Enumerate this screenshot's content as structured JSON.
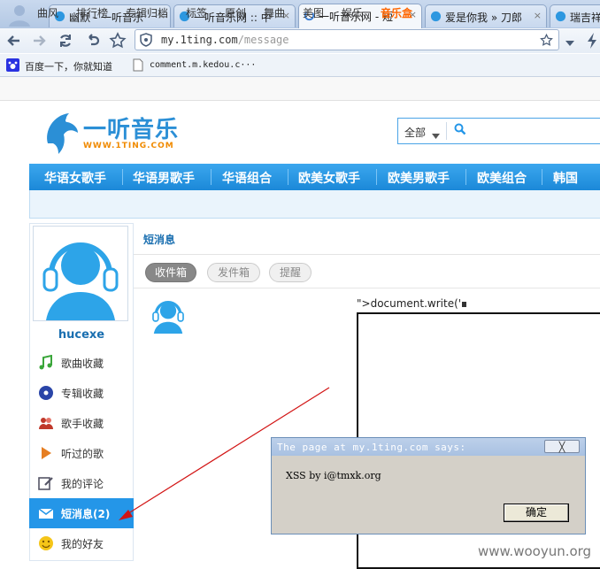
{
  "browser": {
    "tabs": [
      {
        "label": "幽默 - 一听音乐"
      },
      {
        "label": "一听音乐网 :: 中"
      },
      {
        "label": "一听音乐网 - 短"
      },
      {
        "label": "爱是你我 » 刀郎"
      },
      {
        "label": "瑞吉祥"
      }
    ],
    "tab_close": "×",
    "url": {
      "domain": "my.1ting.com",
      "path": "/message"
    },
    "bookmarks": [
      {
        "label": "百度一下，你就知道"
      },
      {
        "label": "comment.m.kedou.c···"
      }
    ]
  },
  "site": {
    "top_menu": [
      "曲风",
      "排行榜",
      "专辑归档",
      "标签",
      "原创",
      "舞曲",
      "美图",
      "娱乐",
      "音乐盒"
    ],
    "logo": {
      "name": "一听音乐",
      "sub": "WWW.1TING.COM"
    },
    "search": {
      "scope": "全部"
    },
    "nav": [
      "华语女歌手",
      "华语男歌手",
      "华语组合",
      "欧美女歌手",
      "欧美男歌手",
      "欧美组合",
      "韩国"
    ]
  },
  "sidebar": {
    "username": "hucexe",
    "items": [
      {
        "label": "歌曲收藏",
        "icon": "music-note-icon"
      },
      {
        "label": "专辑收藏",
        "icon": "disc-icon"
      },
      {
        "label": "歌手收藏",
        "icon": "singers-icon"
      },
      {
        "label": "听过的歌",
        "icon": "play-icon"
      },
      {
        "label": "我的评论",
        "icon": "edit-icon"
      },
      {
        "label": "短消息(2)",
        "icon": "envelope-icon"
      },
      {
        "label": "我的好友",
        "icon": "smiley-icon"
      }
    ]
  },
  "main": {
    "title": "短消息",
    "tabs": [
      "收件箱",
      "发件箱",
      "提醒"
    ],
    "message_text": "\">document.write('"
  },
  "dialog": {
    "title": "The page at my.1ting.com says:",
    "message": "XSS by i@tmxk.org",
    "ok": "确定",
    "close": "╳"
  },
  "watermark": "www.wooyun.org",
  "colors": {
    "accent": "#2496e8",
    "link": "#1a6fb0",
    "highlight": "#ff6600",
    "annotation": "#d21414"
  }
}
